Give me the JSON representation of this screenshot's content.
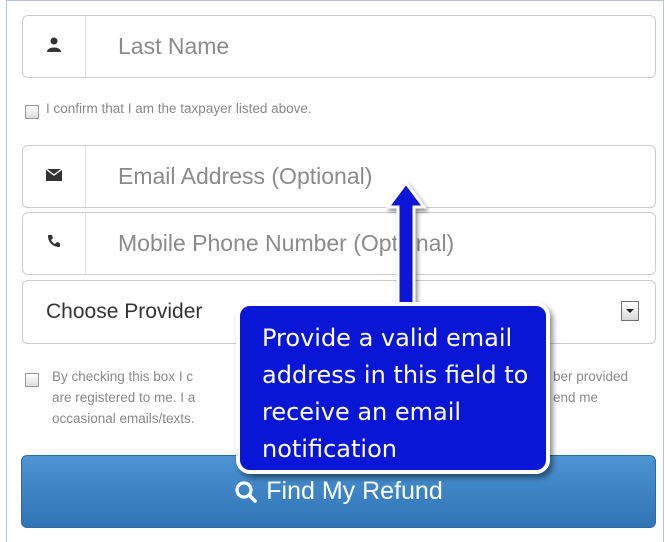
{
  "fields": {
    "last_name_placeholder": "Last Name",
    "email_placeholder": "Email Address (Optional)",
    "phone_placeholder": "Mobile Phone Number (Optional)"
  },
  "taxpayer_confirm": {
    "label": "I confirm that I am the taxpayer listed above.",
    "checked": false
  },
  "provider_select": {
    "selected": "Choose Provider"
  },
  "consent": {
    "line1_left": "By checking this box I c",
    "line1_right": "ber provided",
    "line2_left": "are registered to me. I a",
    "line2_right": "end me",
    "line3_left": "occasional emails/texts.",
    "checked": false
  },
  "submit_button": {
    "label": "Find My Refund"
  },
  "callout": {
    "text": "Provide a valid email address in this field to receive an email notification",
    "fill_color": "#0a16d6"
  },
  "icons": {
    "last_name": "user-icon",
    "email": "envelope-icon",
    "phone": "phone-icon",
    "button": "search-icon"
  }
}
